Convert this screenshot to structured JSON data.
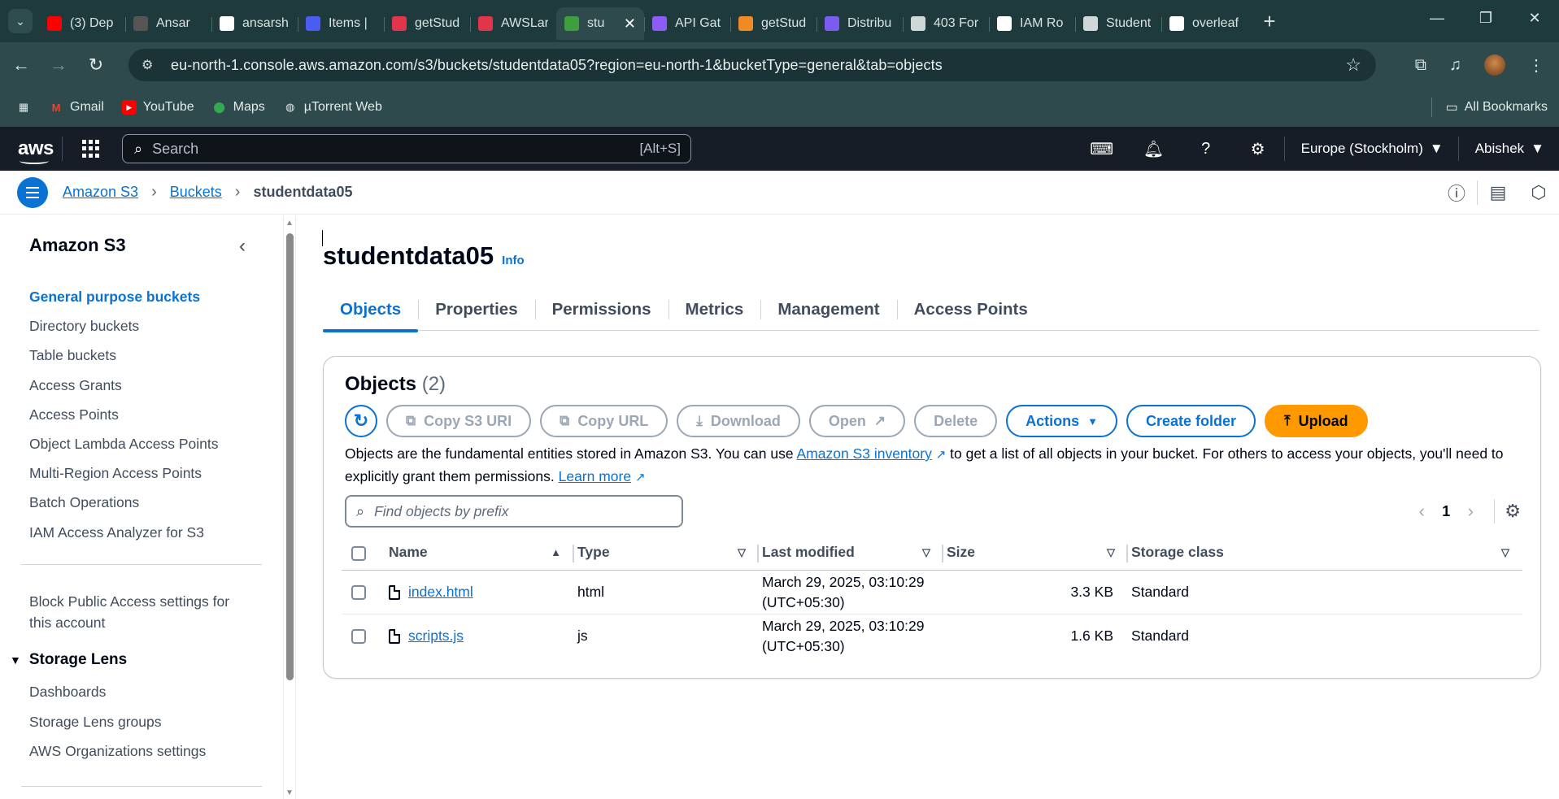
{
  "browser": {
    "tabs": [
      {
        "title": "(3) Dep",
        "icon": "youtube-icon",
        "color": "#ff0000"
      },
      {
        "title": "Ansar",
        "icon": "profile-icon",
        "color": "#555555"
      },
      {
        "title": "ansarsh",
        "icon": "github-icon",
        "color": "#ffffff"
      },
      {
        "title": "Items |",
        "icon": "doc-icon",
        "color": "#4b5cf0"
      },
      {
        "title": "getStud",
        "icon": "aws-red-icon",
        "color": "#e0354a"
      },
      {
        "title": "AWSLar",
        "icon": "aws-red-icon",
        "color": "#e0354a"
      },
      {
        "title": "stu",
        "icon": "s3-icon",
        "color": "#3f9f3f",
        "active": true
      },
      {
        "title": "API Gat",
        "icon": "apigw-icon",
        "color": "#8b5cf6"
      },
      {
        "title": "getStud",
        "icon": "lambda-icon",
        "color": "#f08a24"
      },
      {
        "title": "Distribu",
        "icon": "cloudfront-icon",
        "color": "#7c5cf0"
      },
      {
        "title": "403 For",
        "icon": "globe-icon",
        "color": "#cfd8d9"
      },
      {
        "title": "IAM Ro",
        "icon": "chatgpt-icon",
        "color": "#ffffff"
      },
      {
        "title": "Student",
        "icon": "globe-icon",
        "color": "#cfd8d9"
      },
      {
        "title": "overleaf",
        "icon": "google-icon",
        "color": "#ffffff"
      }
    ],
    "url": "eu-north-1.console.aws.amazon.com/s3/buckets/studentdata05?region=eu-north-1&bucketType=general&tab=objects",
    "bookmarks": [
      {
        "label": "Gmail",
        "icon": "gmail-icon"
      },
      {
        "label": "YouTube",
        "icon": "youtube-icon"
      },
      {
        "label": "Maps",
        "icon": "maps-icon"
      },
      {
        "label": "µTorrent Web",
        "icon": "globe-icon"
      }
    ],
    "all_bookmarks": "All Bookmarks"
  },
  "aws": {
    "logo": "aws",
    "search_placeholder": "Search",
    "search_hint": "[Alt+S]",
    "region": "Europe (Stockholm)",
    "user": "Abishek"
  },
  "breadcrumb": [
    "Amazon S3",
    "Buckets",
    "studentdata05"
  ],
  "sidenav": {
    "title": "Amazon S3",
    "items": [
      "General purpose buckets",
      "Directory buckets",
      "Table buckets",
      "Access Grants",
      "Access Points",
      "Object Lambda Access Points",
      "Multi-Region Access Points",
      "Batch Operations",
      "IAM Access Analyzer for S3"
    ],
    "block_public": "Block Public Access settings for this account",
    "storage_lens": {
      "title": "Storage Lens",
      "items": [
        "Dashboards",
        "Storage Lens groups",
        "AWS Organizations settings"
      ]
    }
  },
  "main": {
    "bucket_name": "studentdata05",
    "info": "Info",
    "tabs": [
      "Objects",
      "Properties",
      "Permissions",
      "Metrics",
      "Management",
      "Access Points"
    ],
    "panel": {
      "title": "Objects",
      "count": "(2)",
      "buttons": {
        "copy_uri": "Copy S3 URI",
        "copy_url": "Copy URL",
        "download": "Download",
        "open": "Open",
        "delete": "Delete",
        "actions": "Actions",
        "create_folder": "Create folder",
        "upload": "Upload"
      },
      "desc_1": "Objects are the fundamental entities stored in Amazon S3. You can use ",
      "desc_link1": "Amazon S3 inventory",
      "desc_2": " to get a list of all objects in your bucket. For others to access your objects, you'll need to explicitly grant them permissions. ",
      "desc_link2": "Learn more",
      "find_placeholder": "Find objects by prefix",
      "page": "1",
      "columns": [
        "Name",
        "Type",
        "Last modified",
        "Size",
        "Storage class"
      ],
      "rows": [
        {
          "name": "index.html",
          "type": "html",
          "modified_1": "March 29, 2025, 03:10:29",
          "modified_2": "(UTC+05:30)",
          "size": "3.3 KB",
          "class": "Standard"
        },
        {
          "name": "scripts.js",
          "type": "js",
          "modified_1": "March 29, 2025, 03:10:29",
          "modified_2": "(UTC+05:30)",
          "size": "1.6 KB",
          "class": "Standard"
        }
      ]
    }
  },
  "colors": {
    "accent": "#0972d3",
    "upload": "#ff9900",
    "aws_header": "#161d26",
    "browser_frame": "#2e4a4d"
  }
}
